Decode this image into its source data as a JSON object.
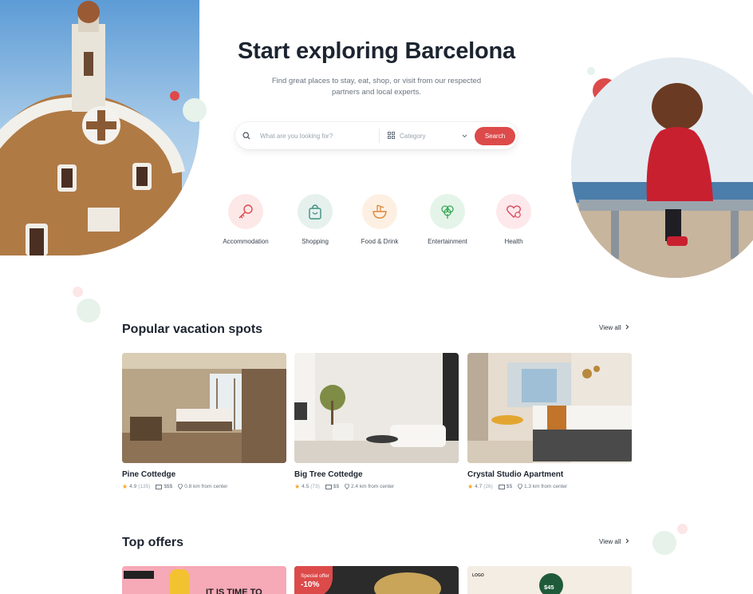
{
  "hero": {
    "title": "Start exploring Barcelona",
    "subtitle": "Find great places to stay, eat, shop, or visit from our respected partners and local experts."
  },
  "search": {
    "placeholder": "What are you looking for?",
    "category_label": "Category",
    "button_label": "Search"
  },
  "categories": [
    {
      "label": "Accommodation",
      "icon": "key-icon",
      "bg": "#fde8e8",
      "color": "#dc4a4a"
    },
    {
      "label": "Shopping",
      "icon": "shopping-bag-icon",
      "bg": "#e6f1ee",
      "color": "#3f8f7f"
    },
    {
      "label": "Food & Drink",
      "icon": "noodles-icon",
      "bg": "#fdf0e2",
      "color": "#e0883a"
    },
    {
      "label": "Entertainment",
      "icon": "tree-icon",
      "bg": "#e5f4e8",
      "color": "#3aa95a"
    },
    {
      "label": "Health",
      "icon": "heart-icon",
      "bg": "#fde8ec",
      "color": "#dc4a5e"
    }
  ],
  "popular": {
    "title": "Popular vacation spots",
    "view_all": "View all",
    "cards": [
      {
        "title": "Pine Cottedge",
        "rating": "4.9",
        "reviews": "(135)",
        "price": "$$$",
        "distance": "0.8 km from center"
      },
      {
        "title": "Big Tree Cottedge",
        "rating": "4.5",
        "reviews": "(73)",
        "price": "$$",
        "distance": "2.4 km from center"
      },
      {
        "title": "Crystal Studio Apartment",
        "rating": "4.7",
        "reviews": "(26)",
        "price": "$$",
        "distance": "1.3 km from center"
      }
    ]
  },
  "offers": {
    "title": "Top offers",
    "view_all": "View all",
    "items": [
      {
        "tag": "",
        "text": "IT IS TIME TO"
      },
      {
        "tag": "Special offer",
        "discount": "-10%"
      },
      {
        "tag": "LOGO",
        "price": "$45"
      }
    ]
  },
  "colors": {
    "accent": "#dc4a4a",
    "title": "#1c2430",
    "muted": "#6a7380"
  }
}
